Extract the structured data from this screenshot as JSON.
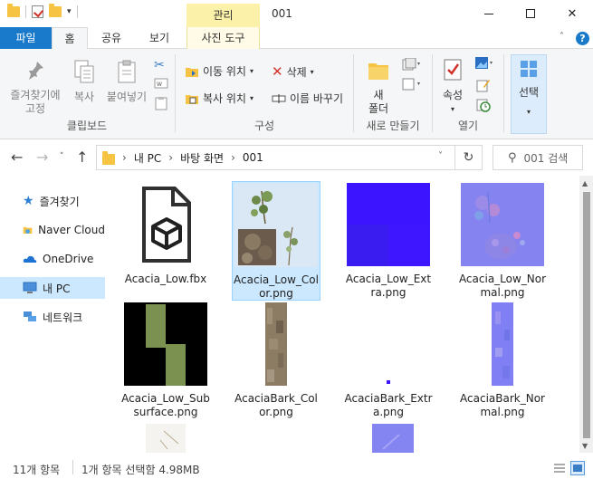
{
  "window": {
    "title": "001",
    "manage_tab": "관리"
  },
  "tabs": [
    {
      "label": "파일"
    },
    {
      "label": "홈"
    },
    {
      "label": "공유"
    },
    {
      "label": "보기"
    },
    {
      "label": "사진 도구"
    }
  ],
  "ribbon": {
    "clipboard": {
      "pin_label_1": "즐겨찾기에",
      "pin_label_2": "고정",
      "copy": "복사",
      "paste": "붙여넣기",
      "group": "클립보드"
    },
    "organize": {
      "move_to": "이동 위치",
      "copy_to": "복사 위치",
      "delete": "삭제",
      "rename": "이름 바꾸기",
      "group": "구성"
    },
    "new": {
      "new_folder_1": "새",
      "new_folder_2": "폴더",
      "group": "새로 만들기"
    },
    "open": {
      "properties": "속성",
      "group": "열기"
    },
    "select": {
      "select": "선택"
    }
  },
  "address": {
    "crumbs": [
      "내 PC",
      "바탕 화면",
      "001"
    ],
    "search_placeholder": "001 검색"
  },
  "nav": [
    {
      "label": "즐겨찾기",
      "icon": "star-icon"
    },
    {
      "label": "Naver Cloud",
      "icon": "cloud-folder-icon"
    },
    {
      "label": "OneDrive",
      "icon": "onedrive-icon"
    },
    {
      "label": "내 PC",
      "icon": "pc-icon"
    },
    {
      "label": "네트워크",
      "icon": "network-icon"
    }
  ],
  "files": [
    {
      "name": "Acacia_Low.fbx",
      "type": "fbx"
    },
    {
      "name": "Acacia_Low_Color.png",
      "type": "color"
    },
    {
      "name": "Acacia_Low_Extra.png",
      "type": "extra"
    },
    {
      "name": "Acacia_Low_Normal.png",
      "type": "normal"
    },
    {
      "name": "Acacia_Low_Subsurface.png",
      "type": "subsurface"
    },
    {
      "name": "AcaciaBark_Color.png",
      "type": "bark-color"
    },
    {
      "name": "AcaciaBark_Extra.png",
      "type": "bark-extra"
    },
    {
      "name": "AcaciaBark_Normal.png",
      "type": "bark-normal"
    }
  ],
  "status": {
    "count": "11개 항목",
    "selection": "1개 항목 선택함 4.98MB"
  },
  "colors": {
    "accent": "#1979ca",
    "selection": "#cce8ff",
    "manage": "#fbf1a8"
  }
}
